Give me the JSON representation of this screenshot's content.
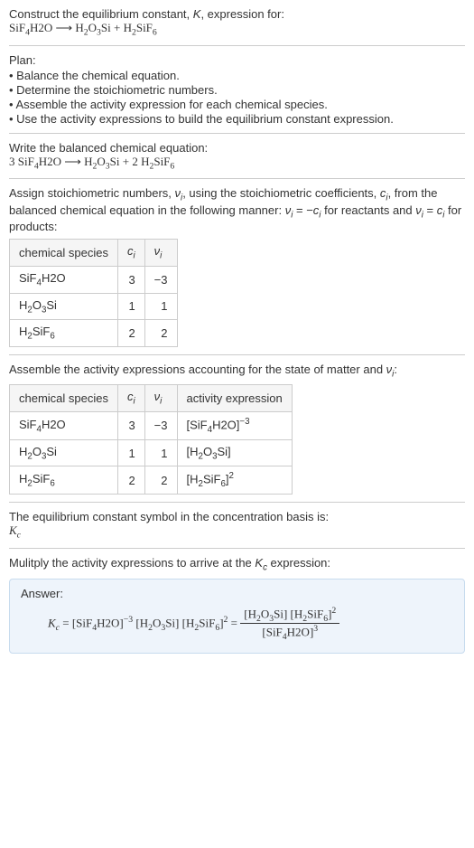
{
  "header": {
    "line1_a": "Construct the equilibrium constant, ",
    "line1_k": "K",
    "line1_b": ", expression for:",
    "eq_lhs": "SiF",
    "eq_lhs2": "4",
    "eq_lhs3": "H2O",
    "arrow": "  ⟶  ",
    "eq_rhs_a": "H",
    "eq_rhs_a2": "2",
    "eq_rhs_a3": "O",
    "eq_rhs_a4": "3",
    "eq_rhs_a5": "Si + H",
    "eq_rhs_a6": "2",
    "eq_rhs_a7": "SiF",
    "eq_rhs_a8": "6"
  },
  "plan": {
    "title": "Plan:",
    "b1": "• Balance the chemical equation.",
    "b2": "• Determine the stoichiometric numbers.",
    "b3": "• Assemble the activity expression for each chemical species.",
    "b4": "• Use the activity expressions to build the equilibrium constant expression."
  },
  "balanced": {
    "title": "Write the balanced chemical equation:",
    "c1": "3 SiF",
    "c1b": "4",
    "c1c": "H2O",
    "arrow": "  ⟶  ",
    "c2": "H",
    "c2b": "2",
    "c2c": "O",
    "c2d": "3",
    "c2e": "Si + 2 H",
    "c2f": "2",
    "c2g": "SiF",
    "c2h": "6"
  },
  "stoich": {
    "intro_a": "Assign stoichiometric numbers, ",
    "nu": "ν",
    "i": "i",
    "intro_b": ", using the stoichiometric coefficients, ",
    "c": "c",
    "intro_c": ", from the balanced chemical equation in the following manner: ",
    "rel_r": " for reactants and ",
    "rel_p": " for products:",
    "h1": "chemical species",
    "h2a": "c",
    "h2b": "ν",
    "r1_sp_a": "SiF",
    "r1_sp_b": "4",
    "r1_sp_c": "H2O",
    "r1_c": "3",
    "r1_v": "−3",
    "r2_sp_a": "H",
    "r2_sp_b": "2",
    "r2_sp_c": "O",
    "r2_sp_d": "3",
    "r2_sp_e": "Si",
    "r2_c": "1",
    "r2_v": "1",
    "r3_sp_a": "H",
    "r3_sp_b": "2",
    "r3_sp_c": "SiF",
    "r3_sp_d": "6",
    "r3_c": "2",
    "r3_v": "2"
  },
  "activity": {
    "intro_a": "Assemble the activity expressions accounting for the state of matter and ",
    "nu": "ν",
    "i": "i",
    "intro_b": ":",
    "h1": "chemical species",
    "h2": "c",
    "h3": "ν",
    "h4": "activity expression",
    "r1_c": "3",
    "r1_v": "−3",
    "r1_act_a": "[SiF",
    "r1_act_b": "4",
    "r1_act_c": "H2O]",
    "r1_exp": "−3",
    "r2_c": "1",
    "r2_v": "1",
    "r2_act_a": "[H",
    "r2_act_b": "2",
    "r2_act_c": "O",
    "r2_act_d": "3",
    "r2_act_e": "Si]",
    "r3_c": "2",
    "r3_v": "2",
    "r3_act_a": "[H",
    "r3_act_b": "2",
    "r3_act_c": "SiF",
    "r3_act_d": "6",
    "r3_act_e": "]",
    "r3_exp": "2"
  },
  "symbol": {
    "line": "The equilibrium constant symbol in the concentration basis is:",
    "K": "K",
    "c": "c"
  },
  "mult": {
    "line_a": "Mulitply the activity expressions to arrive at the ",
    "K": "K",
    "c": "c",
    "line_b": " expression:"
  },
  "answer": {
    "label": "Answer:",
    "Kc_K": "K",
    "Kc_c": "c",
    "eq": " = ",
    "t1_a": "[SiF",
    "t1_b": "4",
    "t1_c": "H2O]",
    "t1_exp": "−3",
    "sp1": " ",
    "t2_a": "[H",
    "t2_b": "2",
    "t2_c": "O",
    "t2_d": "3",
    "t2_e": "Si]",
    "sp2": " ",
    "t3_a": "[H",
    "t3_b": "2",
    "t3_c": "SiF",
    "t3_d": "6",
    "t3_e": "]",
    "t3_exp": "2",
    "eq2": " = ",
    "num_a": "[H",
    "num_b": "2",
    "num_c": "O",
    "num_d": "3",
    "num_e": "Si] [H",
    "num_f": "2",
    "num_g": "SiF",
    "num_h": "6",
    "num_i": "]",
    "num_exp": "2",
    "den_a": "[SiF",
    "den_b": "4",
    "den_c": "H2O]",
    "den_exp": "3"
  }
}
